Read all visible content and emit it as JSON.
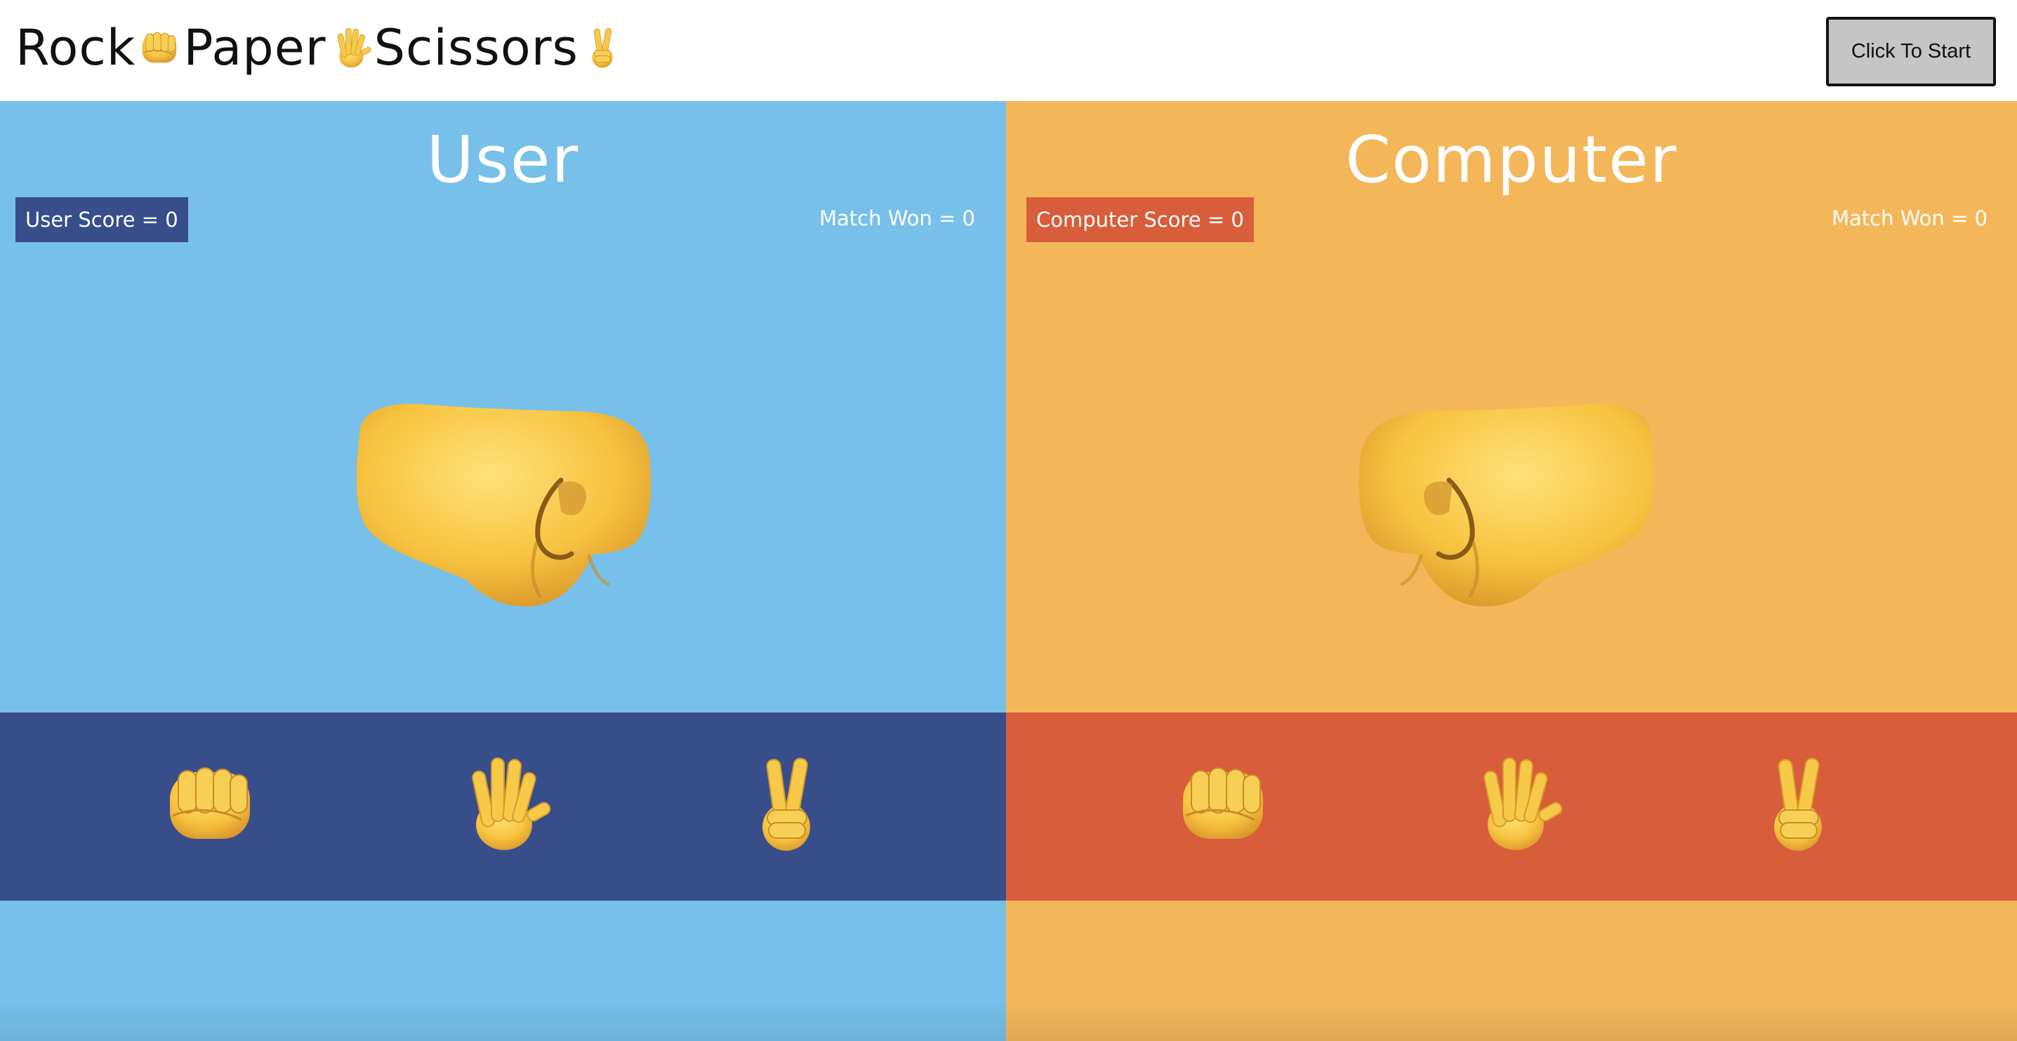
{
  "header": {
    "title_words": [
      "Rock",
      "Paper",
      "Scissors"
    ],
    "title_icons": [
      "fist-icon",
      "raised-hand-icon",
      "victory-hand-icon"
    ],
    "start_button_label": "Click To Start"
  },
  "user_panel": {
    "title": "User",
    "score_label": "User Score = 0",
    "match_won_label": "Match Won = 0",
    "current_choice_icon": "rock-fist-icon",
    "choices": [
      "rock-icon",
      "paper-icon",
      "scissors-icon"
    ]
  },
  "computer_panel": {
    "title": "Computer",
    "score_label": "Computer Score = 0",
    "match_won_label": "Match Won = 0",
    "current_choice_icon": "rock-fist-icon",
    "choices": [
      "rock-icon",
      "paper-icon",
      "scissors-icon"
    ]
  },
  "colors": {
    "user_bg": "#77c0ea",
    "user_accent": "#374e8a",
    "computer_bg": "#f3b75a",
    "computer_accent": "#d85d3b",
    "hand_yellow": "#f7c948"
  }
}
